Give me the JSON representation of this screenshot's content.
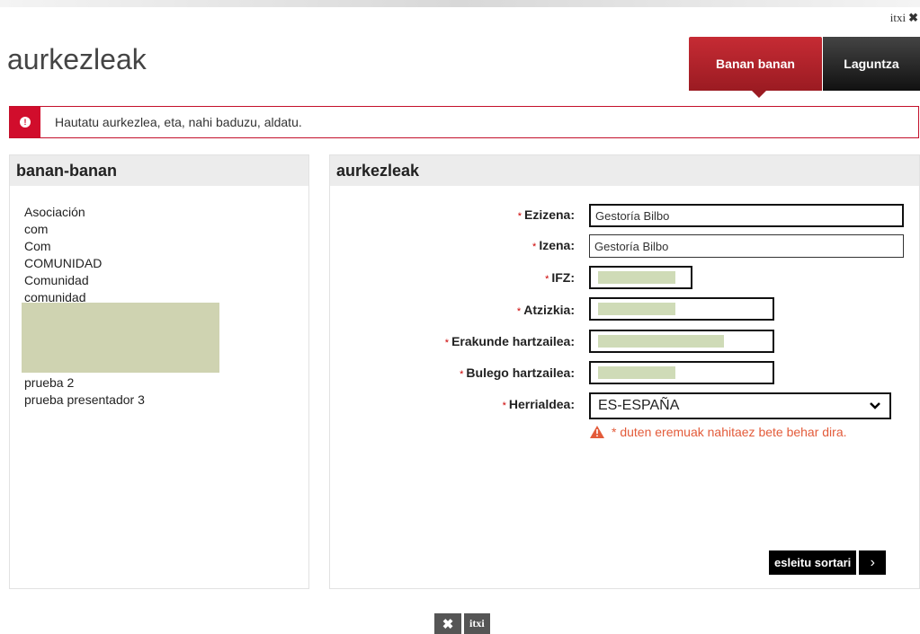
{
  "top": {
    "close_label": "itxi",
    "close_icon": "✖"
  },
  "page_title": "aurkezleak",
  "tabs": [
    {
      "label": "Banan banan",
      "active": true
    },
    {
      "label": "Laguntza",
      "active": false
    }
  ],
  "notice": {
    "text": "Hautatu aurkezlea, eta, nahi baduzu, aldatu."
  },
  "left_panel": {
    "title": "banan-banan",
    "items": [
      "Asociación",
      "com",
      "Com",
      "COMUNIDAD",
      "Comunidad",
      "comunidad",
      "prueba 2",
      "prueba presentador 3"
    ]
  },
  "right_panel": {
    "title": "aurkezleak",
    "required_marker": "*",
    "fields": {
      "ezizena": {
        "label": "Ezizena:",
        "value": "Gestoría Bilbo"
      },
      "izena": {
        "label": "Izena:",
        "value": "Gestoría Bilbo"
      },
      "ifz": {
        "label": "IFZ:",
        "value": ""
      },
      "atzizkia": {
        "label": "Atzizkia:",
        "value": ""
      },
      "erakunde": {
        "label": "Erakunde hartzailea:",
        "value": ""
      },
      "bulego": {
        "label": "Bulego hartzailea:",
        "value": ""
      },
      "herrialdea": {
        "label": "Herrialdea:",
        "value": "ES-ESPAÑA"
      }
    },
    "required_note": "* duten eremuak nahitaez bete behar dira.",
    "assign_button": "esleitu sortari",
    "assign_arrow": "›"
  },
  "bottom": {
    "close_icon": "✖",
    "close_label": "itxi"
  },
  "colors": {
    "accent": "#c62b34",
    "warning": "#e35b3a",
    "redaction": "#cfd3b1"
  }
}
